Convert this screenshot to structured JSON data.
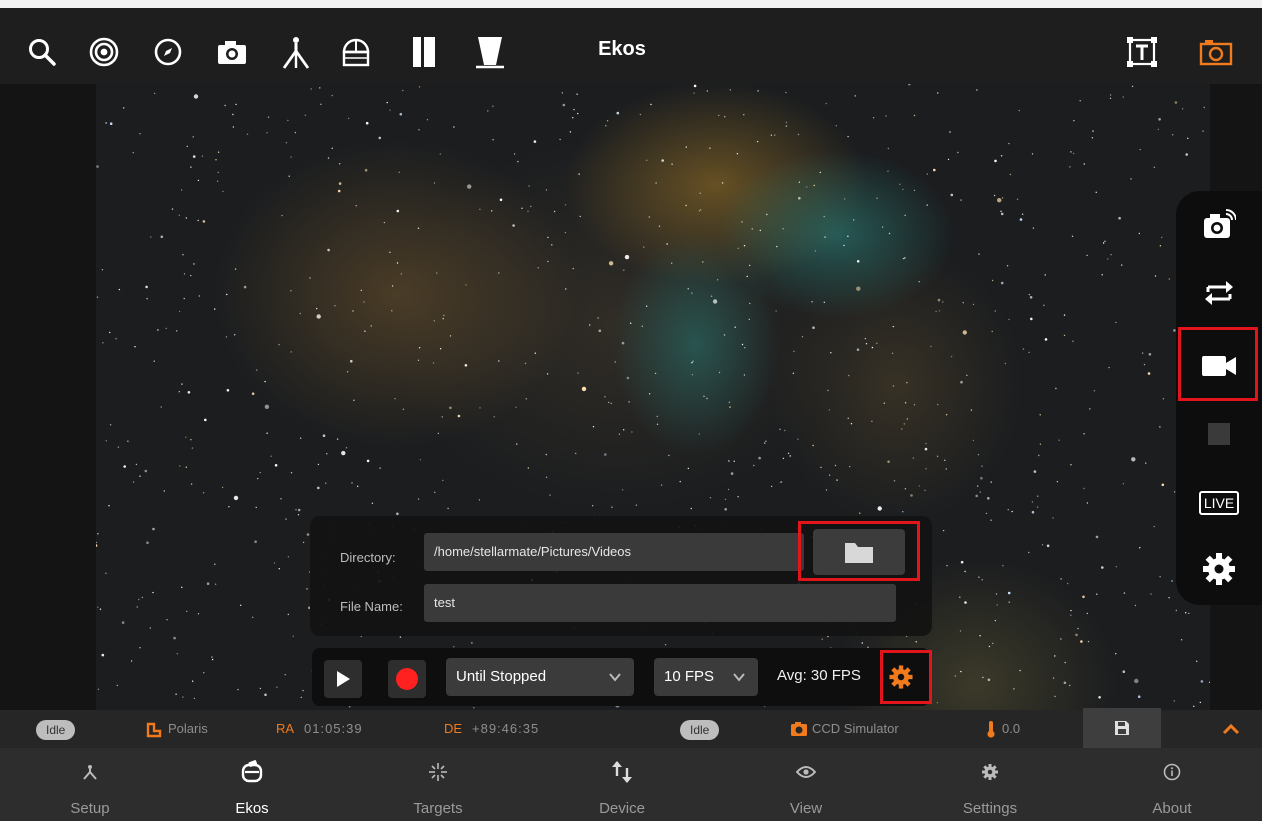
{
  "topbar": {
    "title": "Ekos",
    "left_icons": [
      "search-icon",
      "target-icon",
      "compass-icon",
      "camera-icon",
      "tripod-icon",
      "dome-icon",
      "filter-icon",
      "flat-panel-icon"
    ],
    "right_icons": [
      "text-overlay-icon",
      "capture-frame-icon"
    ]
  },
  "camera_toolbar": {
    "items": [
      "remote-capture-icon",
      "loop-icon",
      "video-record-icon",
      "stop-icon",
      "live-icon",
      "settings-gear-icon"
    ],
    "live_label": "LIVE"
  },
  "video_panel": {
    "directory_label": "Directory:",
    "directory_value": "/home/stellarmate/Pictures/Videos",
    "filename_label": "File Name:",
    "filename_value": "test"
  },
  "controls": {
    "duration_select": "Until Stopped",
    "fps_select": "10 FPS",
    "avg_label": "Avg: 30  FPS"
  },
  "status": {
    "mount_state": "Idle",
    "mount_target": "Polaris",
    "ra_label": "RA",
    "ra_value": "01:05:39",
    "de_label": "DE",
    "de_value": "+89:46:35",
    "camera_state": "Idle",
    "camera_name": "CCD Simulator",
    "temperature": "0.0"
  },
  "nav": {
    "items": [
      {
        "label": "Setup",
        "icon": "setup-icon"
      },
      {
        "label": "Ekos",
        "icon": "ekos-icon"
      },
      {
        "label": "Targets",
        "icon": "targets-icon"
      },
      {
        "label": "Device",
        "icon": "device-icon"
      },
      {
        "label": "View",
        "icon": "eye-icon"
      },
      {
        "label": "Settings",
        "icon": "gear-icon"
      },
      {
        "label": "About",
        "icon": "info-icon"
      }
    ],
    "active": "Ekos"
  },
  "colors": {
    "accent_orange": "#f07a1c",
    "highlight_red": "#e2141c",
    "record_red": "#ff2020"
  }
}
